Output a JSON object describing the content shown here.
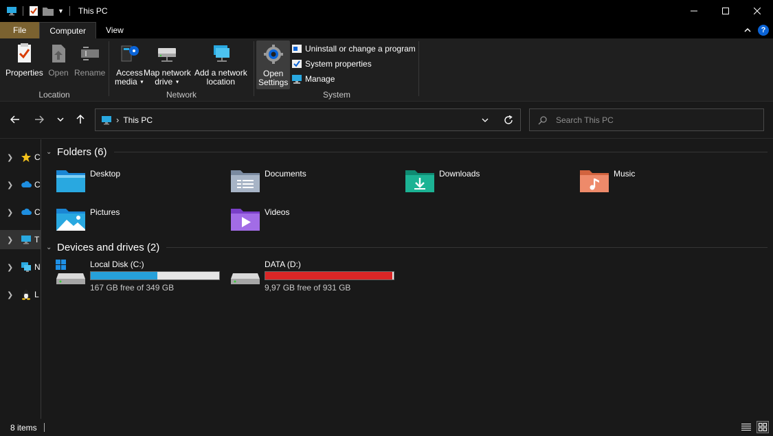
{
  "window": {
    "title": "This PC",
    "controls": [
      "minimize",
      "maximize",
      "close"
    ]
  },
  "ribbon_tabs": [
    {
      "label": "File"
    },
    {
      "label": "Computer"
    },
    {
      "label": "View"
    }
  ],
  "ribbon": {
    "location": {
      "label": "Location",
      "properties": "Properties",
      "open": "Open",
      "rename": "Rename"
    },
    "network": {
      "label": "Network",
      "access_media_1": "Access",
      "access_media_2": "media",
      "map_drive_1": "Map network",
      "map_drive_2": "drive",
      "add_location_1": "Add a network",
      "add_location_2": "location"
    },
    "system": {
      "label": "System",
      "open_settings_1": "Open",
      "open_settings_2": "Settings",
      "uninstall": "Uninstall or change a program",
      "system_properties": "System properties",
      "manage": "Manage"
    }
  },
  "nav": {
    "address": "This PC",
    "search_placeholder": "Search This PC"
  },
  "sidebar": {
    "items": [
      {
        "label": "C",
        "icon": "star-icon"
      },
      {
        "label": "C",
        "icon": "cloud-icon"
      },
      {
        "label": "C",
        "icon": "cloud-icon"
      },
      {
        "label": "T",
        "icon": "monitor-icon",
        "selected": true
      },
      {
        "label": "N",
        "icon": "network-icon"
      },
      {
        "label": "L",
        "icon": "linux-icon"
      }
    ]
  },
  "folders_section": {
    "title": "Folders (6)",
    "items": [
      {
        "name": "Desktop",
        "icon": "desktop-folder-icon"
      },
      {
        "name": "Documents",
        "icon": "documents-folder-icon"
      },
      {
        "name": "Downloads",
        "icon": "downloads-folder-icon"
      },
      {
        "name": "Music",
        "icon": "music-folder-icon"
      },
      {
        "name": "Pictures",
        "icon": "pictures-folder-icon"
      },
      {
        "name": "Videos",
        "icon": "videos-folder-icon"
      }
    ]
  },
  "drives_section": {
    "title": "Devices and drives (2)",
    "items": [
      {
        "name": "Local Disk (C:)",
        "free": "167 GB free of 349 GB",
        "used_fraction": 0.52,
        "bar_color": "#26a0da"
      },
      {
        "name": "DATA (D:)",
        "free": "9,97 GB free of 931 GB",
        "used_fraction": 0.99,
        "bar_color": "#da2626"
      }
    ]
  },
  "status": {
    "items_count": "8 items"
  },
  "colors": {
    "file_tab": "#7b6230",
    "accent_blue": "#26a0da",
    "warning_red": "#da2626"
  }
}
